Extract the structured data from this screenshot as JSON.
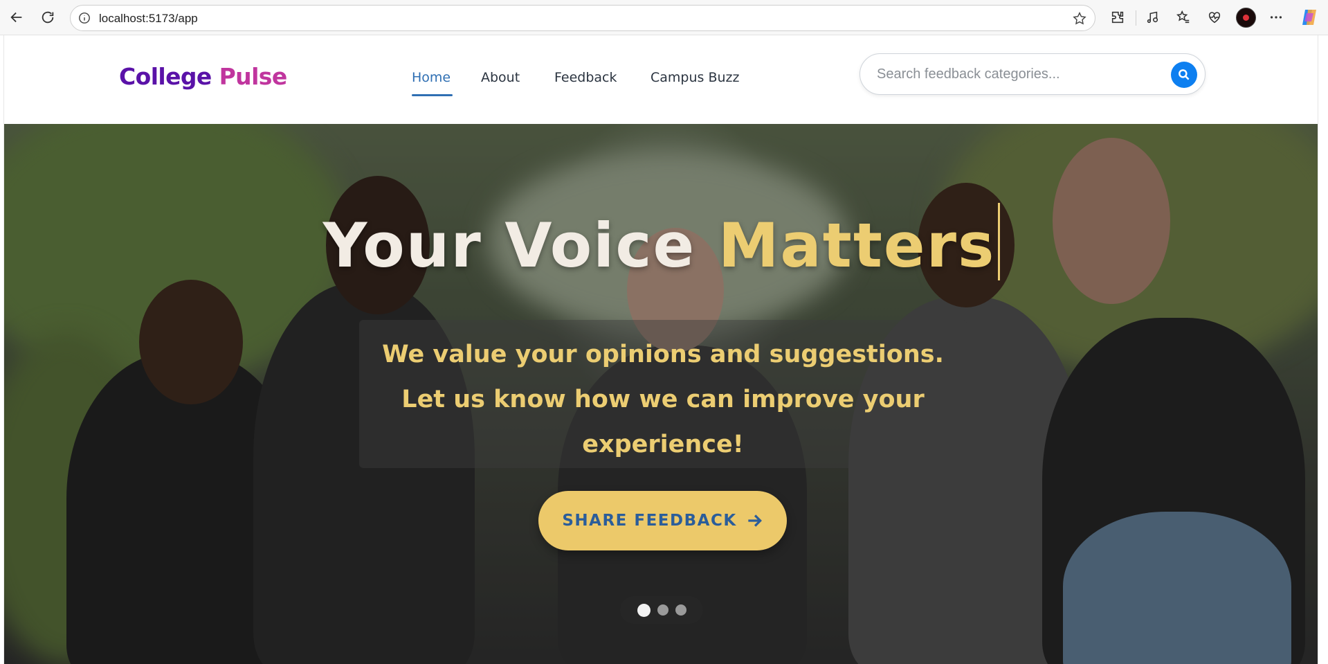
{
  "browser": {
    "url": "localhost:5173/app",
    "icons": [
      "back-arrow-icon",
      "refresh-icon",
      "info-icon",
      "star-icon",
      "extensions-icon",
      "media-icon",
      "favorites-icon",
      "health-icon",
      "profile-avatar",
      "more-icon",
      "copilot-icon"
    ]
  },
  "header": {
    "logo_part1": "College",
    "logo_part2": "Pulse",
    "nav": [
      {
        "label": "Home",
        "active": true
      },
      {
        "label": "About",
        "active": false
      },
      {
        "label": "Feedback",
        "active": false
      },
      {
        "label": "Campus Buzz",
        "active": false
      }
    ],
    "search": {
      "placeholder": "Search feedback categories...",
      "button_icon": "search-icon"
    }
  },
  "hero": {
    "title_white": "Your Voice",
    "title_gold": "Matters",
    "subtitle": "We value your opinions and suggestions. Let us know how we can improve your experience!",
    "cta_label": "SHARE FEEDBACK",
    "cta_icon": "arrow-right-icon",
    "carousel": {
      "slides": 3,
      "active_slide": 1
    }
  },
  "colors": {
    "logo_purple": "#5a12a8",
    "logo_pink": "#c0359e",
    "nav_active": "#2f6fb3",
    "gold": "#eccd72",
    "search_button": "#0d7ff0"
  }
}
